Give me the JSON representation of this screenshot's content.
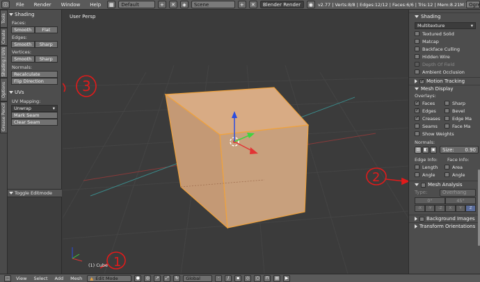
{
  "top": {
    "menus": [
      "File",
      "Render",
      "Window",
      "Help"
    ],
    "layout": "Default",
    "scene": "Scene",
    "engine": "Blender Render",
    "stats": "v2.77 | Verts:8/8 | Edges:12/12 | Faces:6/6 | Tris:12 | Mem:8.21M | Cube",
    "right_clip": "Ogre"
  },
  "tabs": [
    "Tools",
    "Create",
    "Shading / UVs",
    "Options",
    "Grease Pencil"
  ],
  "left": {
    "shading_header": "Shading",
    "faces_label": "Faces:",
    "faces_btns": [
      "Smooth",
      "Flat"
    ],
    "edges_label": "Edges:",
    "edges_btns": [
      "Smooth",
      "Sharp"
    ],
    "vertices_label": "Vertices:",
    "vertices_btns": [
      "Smooth",
      "Sharp"
    ],
    "normals_label": "Normals:",
    "recalculate": "Recalculate",
    "flip": "Flip Direction",
    "uvs_header": "UVs",
    "uvmap_label": "UV Mapping:",
    "unwrap": "Unwrap",
    "mark_seam": "Mark Seam",
    "clear_seam": "Clear Seam",
    "toggle_edit": "Toggle Editmode"
  },
  "viewport": {
    "title": "User Persp",
    "object": "(1) Cube"
  },
  "right": {
    "shading_header": "Shading",
    "shading_mode": "Multitexture",
    "shading_checks": [
      {
        "label": "Textured Solid",
        "on": false,
        "dim": false
      },
      {
        "label": "Matcap",
        "on": false,
        "dim": false
      },
      {
        "label": "Backface Culling",
        "on": false,
        "dim": false
      },
      {
        "label": "Hidden Wire",
        "on": false,
        "dim": false
      },
      {
        "label": "Depth Of Field",
        "on": false,
        "dim": true
      },
      {
        "label": "Ambient Occlusion",
        "on": false,
        "dim": false
      }
    ],
    "motion_tracking": "Motion Tracking",
    "mesh_display": "Mesh Display",
    "overlays_label": "Overlays:",
    "overlays_left": [
      {
        "label": "Faces",
        "on": true
      },
      {
        "label": "Edges",
        "on": true
      },
      {
        "label": "Creases",
        "on": true
      },
      {
        "label": "Seams",
        "on": false
      }
    ],
    "overlays_right": [
      {
        "label": "Sharp",
        "on": false
      },
      {
        "label": "Bevel",
        "on": false
      },
      {
        "label": "Edge Ma",
        "on": false
      },
      {
        "label": "Face Ma",
        "on": false
      }
    ],
    "show_weights": "Show Weights",
    "normals_label": "Normals:",
    "size_label": "Size:",
    "size_value": "0.90",
    "edge_info": "Edge Info:",
    "face_info": "Face Info:",
    "edge_checks": [
      "Length",
      "Angle"
    ],
    "face_checks": [
      "Area",
      "Angle"
    ],
    "mesh_analysis": "Mesh Analysis",
    "type_label": "Type:",
    "type_value": "Overhang",
    "range_min": "0°",
    "range_max": "45°",
    "axis_btns": [
      "-X",
      "-Y",
      "-Z",
      "X",
      "Y",
      "Z"
    ],
    "bg_images": "Background Images",
    "transform_orient": "Transform Orientations"
  },
  "bottom": {
    "menus": [
      "View",
      "Select",
      "Add",
      "Mesh"
    ],
    "mode": "Edit Mode",
    "pivot": "Global"
  },
  "annotations": [
    "1",
    "2",
    "3"
  ],
  "colors": {
    "cube_fill": "#c9a07f",
    "cube_edge": "#f0a23c",
    "annotation": "#e11b1b",
    "x_axis": "#e23434",
    "y_axis": "#3fd43f",
    "z_axis": "#2a4de0"
  }
}
